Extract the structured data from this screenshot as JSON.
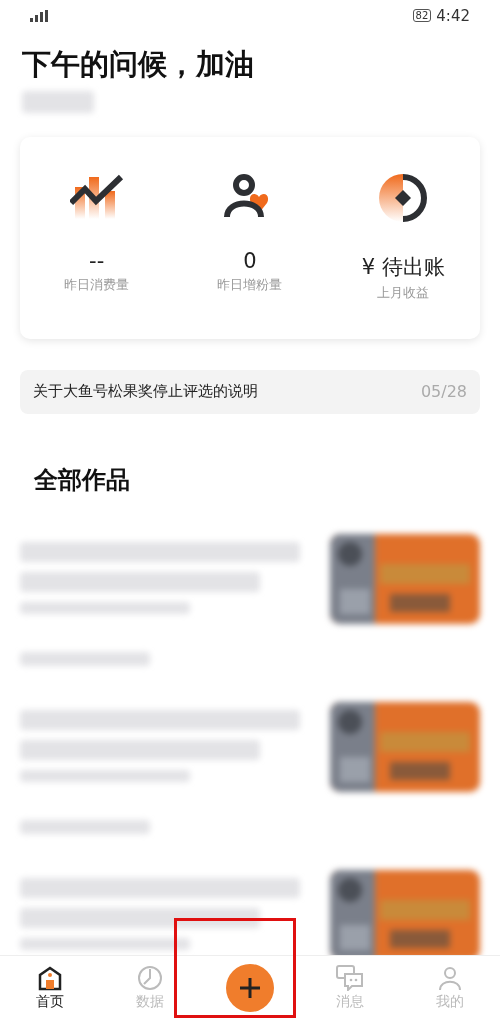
{
  "status_bar": {
    "time": "4:42",
    "battery": "82"
  },
  "greeting": "下午的问候，加油",
  "stats": [
    {
      "kind": "trend",
      "value": "--",
      "label": "昨日消费量"
    },
    {
      "kind": "fans",
      "value": "0",
      "label": "昨日增粉量"
    },
    {
      "kind": "income",
      "value": "¥ 待出账",
      "label": "上月收益"
    }
  ],
  "notice": {
    "text": "关于大鱼号松果奖停止评选的说明",
    "date": "05/28"
  },
  "section_title": "全部作品",
  "nav": [
    {
      "kind": "home",
      "label": "首页",
      "selected": true
    },
    {
      "kind": "data",
      "label": "数据",
      "selected": false
    },
    {
      "kind": "add"
    },
    {
      "kind": "message",
      "label": "消息",
      "selected": false
    },
    {
      "kind": "me",
      "label": "我的",
      "selected": false
    }
  ]
}
